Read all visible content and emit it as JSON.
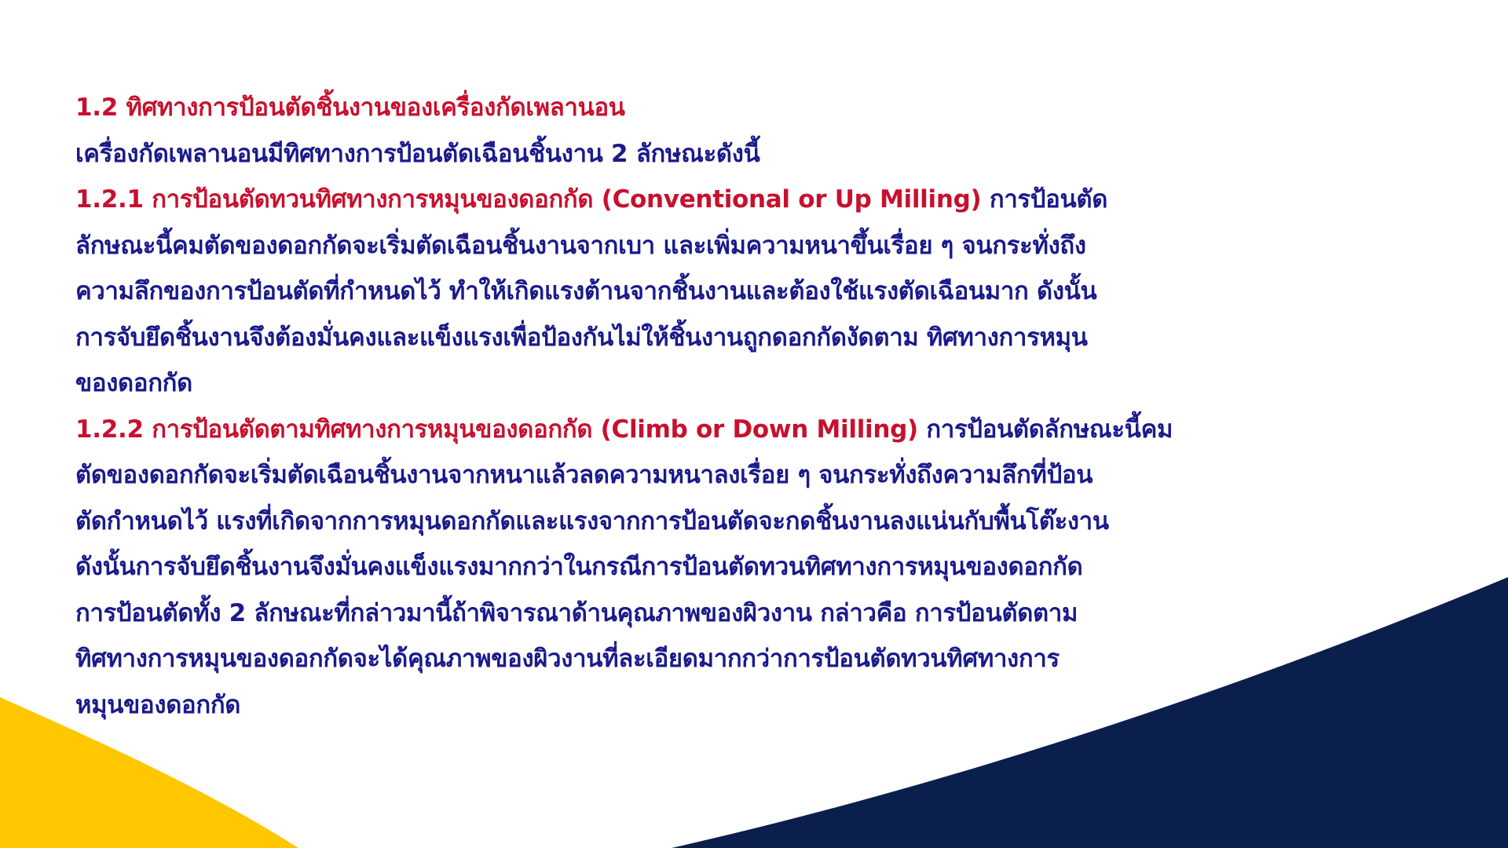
{
  "colors": {
    "heading_red": "#c8102e",
    "body_blue": "#1a1a8c",
    "accent_yellow": "#ffc700",
    "accent_navy": "#0b1f4d",
    "background": "#ffffff"
  },
  "heading": "1.2 ทิศทางการป้อนตัดชิ้นงานของเครื่องกัดเพลานอน",
  "intro": "เครื่องกัดเพลานอนมีทิศทางการป้อนตัดเฉือนชิ้นงาน 2 ลักษณะดังนี้",
  "section_1": {
    "title": "1.2.1 การป้อนตัดทวนทิศทางการหมุนของดอกกัด (Conventional or Up Milling)",
    "line1_tail": " การป้อนตัด",
    "line2": "ลักษณะนี้คมตัดของดอกกัดจะเริ่มตัดเฉือนชิ้นงานจากเบา และเพิ่มความหนาขึ้นเรื่อย ๆ จนกระทั่งถึง",
    "line3": "ความลึกของการป้อนตัดที่กำหนดไว้ ทำให้เกิดแรงต้านจากชิ้นงานและต้องใช้แรงตัดเฉือนมาก ดังนั้น",
    "line4": "การจับยึดชิ้นงานจึงต้องมั่นคงและแข็งแรงเพื่อป้องกันไม่ให้ชิ้นงานถูกดอกกัดงัดตาม ทิศทางการหมุน",
    "line5": "ของดอกกัด"
  },
  "section_2": {
    "title": "1.2.2 การป้อนตัดตามทิศทางการหมุนของดอกกัด (Climb or Down Milling)",
    "line1_tail": " การป้อนตัดลักษณะนี้คม",
    "line2": "ตัดของดอกกัดจะเริ่มตัดเฉือนชิ้นงานจากหนาแล้วลดความหนาลงเรื่อย ๆ จนกระทั่งถึงความลึกที่ป้อน",
    "line3": "ตัดกำหนดไว้ แรงที่เกิดจากการหมุนดอกกัดและแรงจากการป้อนตัดจะกดชิ้นงานลงแน่นกับพื้นโต๊ะงาน",
    "line4": "ดังนั้นการจับยึดชิ้นงานจึงมั่นคงแข็งแรงมากกว่าในกรณีการป้อนตัดทวนทิศทางการหมุนของดอกกัด"
  },
  "summary": {
    "line1": "การป้อนตัดทั้ง 2 ลักษณะที่กล่าวมานี้ถ้าพิจารณาด้านคุณภาพของผิวงาน กล่าวคือ การป้อนตัดตาม",
    "line2": "ทิศทางการหมุนของดอกกัดจะได้คุณภาพของผิวงานที่ละเอียดมากกว่าการป้อนตัดทวนทิศทางการ",
    "line3": "หมุนของดอกกัด"
  }
}
